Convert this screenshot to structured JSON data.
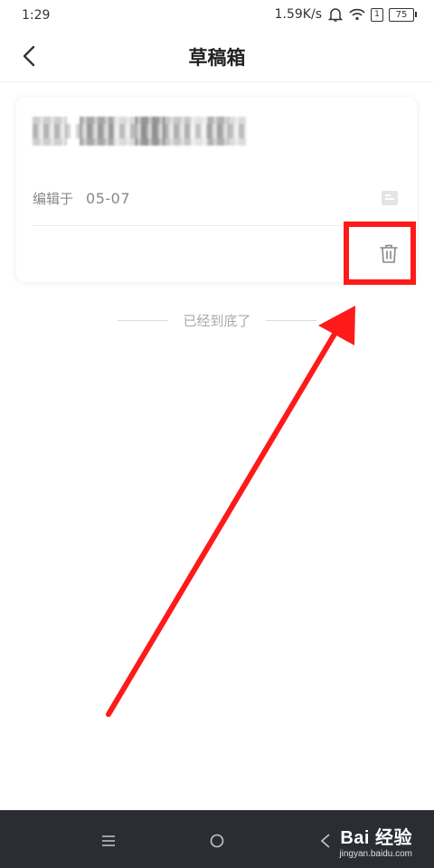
{
  "status_bar": {
    "time": "1:29",
    "speed": "1.59K/s",
    "sim": "1",
    "battery": "75"
  },
  "header": {
    "title": "草稿箱"
  },
  "draft": {
    "edited_label": "编辑于",
    "edited_date": "05-07"
  },
  "list": {
    "end_text": "已经到底了"
  },
  "watermark": {
    "main": "Bai  经验",
    "sub": "jingyan.baidu.com"
  },
  "colors": {
    "highlight": "#ff1a1a",
    "nav_bg": "#2a2d34"
  }
}
